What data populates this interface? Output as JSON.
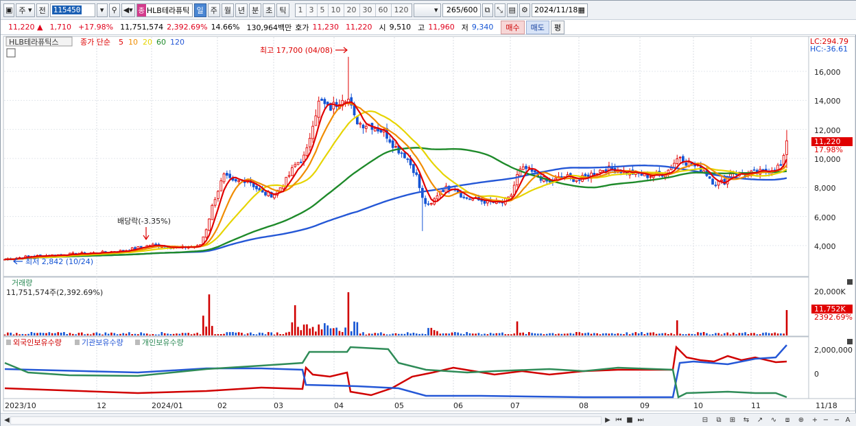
{
  "toolbar": {
    "market_label": "주",
    "prev_label": "전",
    "stock_code": "115450",
    "stock_badge": "종",
    "stock_name": "HLB테라퓨틱",
    "periods": [
      "일",
      "주",
      "월",
      "년",
      "분",
      "초",
      "틱"
    ],
    "active_period": "일",
    "intervals": [
      "1",
      "3",
      "5",
      "10",
      "20",
      "30",
      "60",
      "120"
    ],
    "bar_count": "265",
    "bar_total": "/600",
    "date": "2024/11/18"
  },
  "quote": {
    "price": "11,220",
    "arrow": "▲",
    "change": "1,710",
    "change_pct": "+17.98%",
    "volume": "11,751,574",
    "volume_pct": "2,392.69%",
    "turnover": "14.66%",
    "amount": "130,964백만",
    "ask_label": "호가",
    "ask": "11,230",
    "bid": "11,220",
    "open_label": "시",
    "open": "9,510",
    "high_label": "고",
    "high": "11,960",
    "low_label": "저",
    "low": "9,340",
    "buy_label": "매수",
    "sell_label": "매도",
    "eval_label": "평"
  },
  "price_panel": {
    "stock_label": "HLB테라퓨틱스",
    "ma_title": "종가 단순",
    "ma_periods": [
      {
        "label": "5",
        "color": "#e00000"
      },
      {
        "label": "10",
        "color": "#f08c00"
      },
      {
        "label": "20",
        "color": "#e6d400"
      },
      {
        "label": "60",
        "color": "#1e8a2a"
      },
      {
        "label": "120",
        "color": "#2457d6"
      }
    ],
    "lc": "LC:294.79",
    "hc": "HC:-36.61",
    "high_annotation": "최고 17,700 (04/08)",
    "low_annotation": "최저 2,842 (10/24)",
    "dividend_annotation": "배당락(-3.35%)",
    "y_ticks": [
      "16,000",
      "14,000",
      "12,000",
      "10,000",
      "8,000",
      "6,000",
      "4,000"
    ],
    "current_price_tag": "11,220",
    "current_pct_tag": "17.98%"
  },
  "volume_panel": {
    "title": "거래량",
    "value": "11,751,574주(2,392.69%)",
    "y_tick": "20,000K",
    "current_tag": "11,752K",
    "current_pct": "2392.69%"
  },
  "holding_panel": {
    "series": [
      {
        "label": "외국인보유수량",
        "color": "#d00000"
      },
      {
        "label": "기관보유수량",
        "color": "#2457d6"
      },
      {
        "label": "개인보유수량",
        "color": "#2e8b57"
      }
    ],
    "y_ticks": [
      "2,000,000",
      "0"
    ]
  },
  "x_axis": [
    "2023/10",
    "12",
    "2024/01",
    "02",
    "03",
    "04",
    "05",
    "06",
    "07",
    "08",
    "09",
    "10",
    "11",
    "11/18"
  ],
  "chart_data": {
    "type": "line",
    "title": "HLB테라퓨틱스",
    "ylabel": "",
    "ylim": [
      2600,
      17800
    ],
    "x": [
      "2023/10",
      "12",
      "2024/01",
      "02",
      "03",
      "04",
      "05",
      "06",
      "07",
      "08",
      "09",
      "10",
      "11",
      "11/18"
    ],
    "series": [
      {
        "name": "5",
        "values": [
          3200,
          3400,
          3600,
          3900,
          7600,
          9800,
          13600,
          12000,
          6200,
          7200,
          8600,
          8800,
          9000,
          8200,
          9000,
          11220
        ]
      },
      {
        "name": "120",
        "values": [
          4100,
          3900,
          3650,
          3600,
          4200,
          5200,
          6500,
          7600,
          7900,
          8300,
          8900,
          9200,
          9200,
          9100,
          8700,
          8600
        ]
      }
    ],
    "annotations": [
      "최고 17,700 (04/08)",
      "최저 2,842 (10/24)",
      "배당락(-3.35%)"
    ]
  }
}
